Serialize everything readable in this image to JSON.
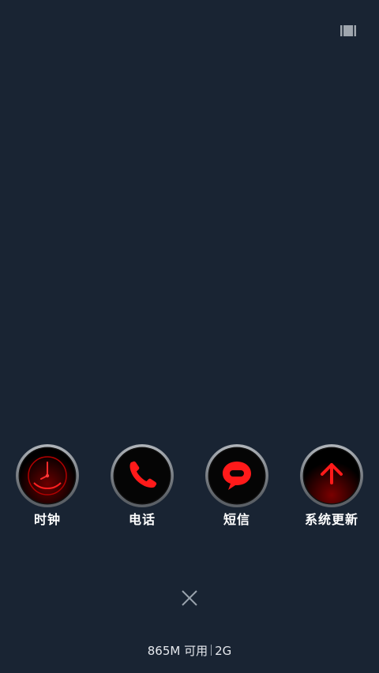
{
  "toolbar": {
    "layout_toggle_icon": "multi-window-icon"
  },
  "apps": [
    {
      "label": "时钟",
      "icon": "clock-icon"
    },
    {
      "label": "电话",
      "icon": "phone-icon"
    },
    {
      "label": "短信",
      "icon": "message-icon"
    },
    {
      "label": "系统更新",
      "icon": "system-update-icon"
    }
  ],
  "close": {
    "icon": "close-icon"
  },
  "memory": {
    "free": "865M 可用",
    "total": "2G"
  },
  "colors": {
    "background": "#192433",
    "accent": "#ff0000",
    "icon_rim": "#c0c4c8",
    "text": "#ffffff"
  }
}
